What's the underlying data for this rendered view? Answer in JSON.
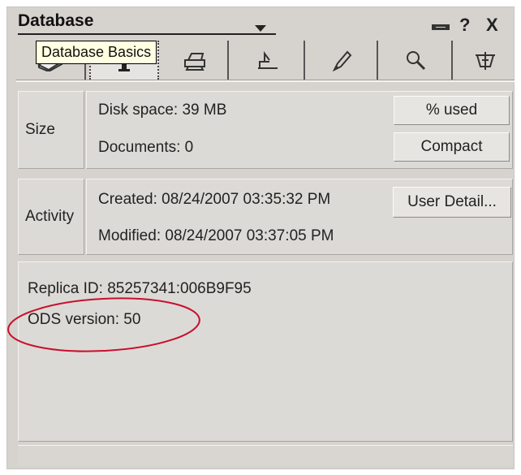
{
  "header": {
    "title": "Database",
    "icons": [
      "dropdown-arrow-icon",
      "pin-icon",
      "help-icon",
      "close-icon"
    ],
    "help_glyph": "?",
    "close_glyph": "X"
  },
  "tooltip": {
    "text": "Database Basics"
  },
  "tabs": [
    {
      "icon": "basics-tab-icon",
      "active": true
    },
    {
      "icon": "info-tab-icon",
      "active": false
    },
    {
      "icon": "print-tab-icon",
      "active": false
    },
    {
      "icon": "design-tab-icon",
      "active": false
    },
    {
      "icon": "launch-tab-icon",
      "active": false
    },
    {
      "icon": "fulltext-search-tab-icon",
      "active": false
    },
    {
      "icon": "advanced-tab-icon",
      "active": false
    }
  ],
  "size": {
    "label": "Size",
    "disk_space": "Disk space: 39 MB",
    "documents": "Documents: 0",
    "used_button": "% used",
    "compact_button": "Compact"
  },
  "activity": {
    "label": "Activity",
    "created": "Created:  08/24/2007 03:35:32 PM",
    "modified": "Modified: 08/24/2007 03:37:05 PM",
    "user_detail_button": "User Detail..."
  },
  "info": {
    "replica_id": "Replica ID:    85257341:006B9F95",
    "ods_version": "ODS version: 50"
  },
  "colors": {
    "panel": "#d6d3ce",
    "tooltip_bg": "#ffffe1",
    "highlight_ellipse": "#c8102e"
  }
}
